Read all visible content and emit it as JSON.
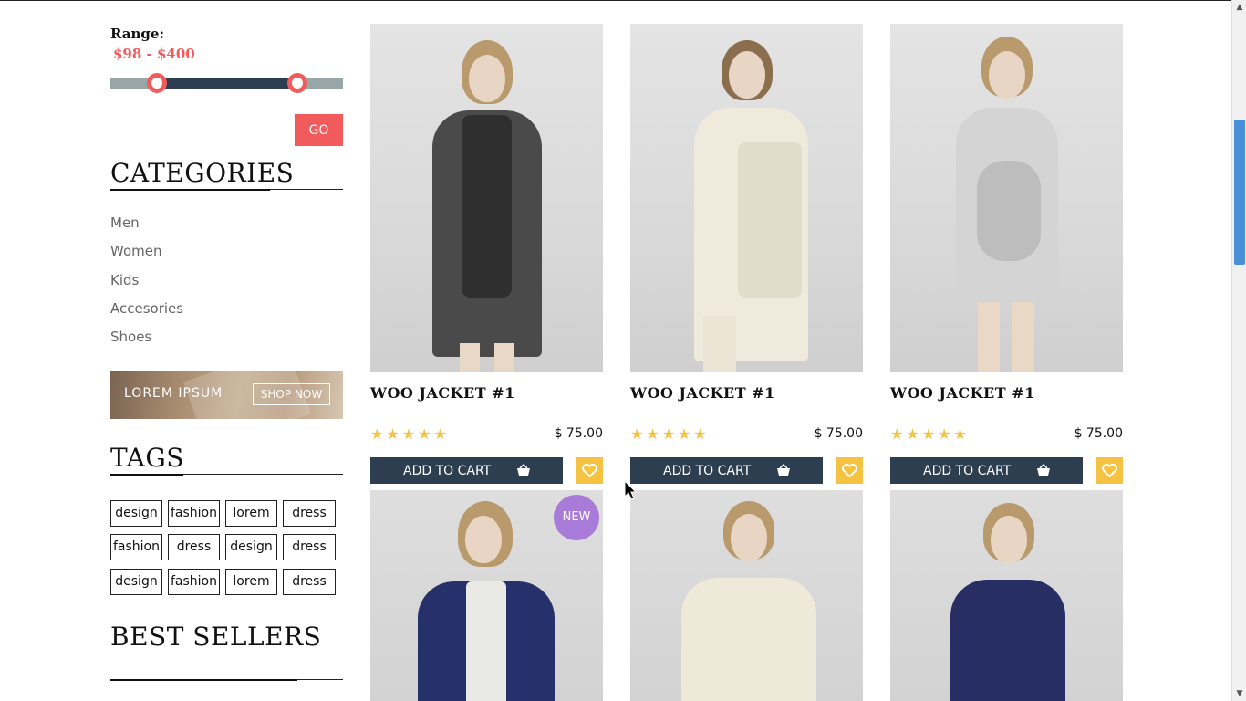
{
  "filter": {
    "range_label": "Range:",
    "range_value": "$98 - $400",
    "range_min": 98,
    "range_max": 400,
    "go_label": "GO"
  },
  "categories": {
    "heading": "CATEGORIES",
    "items": [
      "Men",
      "Women",
      "Kids",
      "Accesories",
      "Shoes"
    ]
  },
  "banner": {
    "text": "LOREM IPSUM",
    "button": "SHOP NOW"
  },
  "tags": {
    "heading": "TAGS",
    "items": [
      "design",
      "fashion",
      "lorem",
      "dress",
      "fashion",
      "dress",
      "design",
      "dress",
      "design",
      "fashion",
      "lorem",
      "dress"
    ]
  },
  "best_sellers": {
    "heading": "BEST SELLERS"
  },
  "products": [
    {
      "title": "WOO JACKET #1",
      "stars": "★★★★★",
      "price": "$ 75.00",
      "cart_label": "ADD TO CART"
    },
    {
      "title": "WOO JACKET #1",
      "stars": "★★★★★",
      "price": "$ 75.00",
      "cart_label": "ADD TO CART"
    },
    {
      "title": "WOO JACKET #1",
      "stars": "★★★★★",
      "price": "$ 75.00",
      "cart_label": "ADD TO CART"
    }
  ],
  "second_row": {
    "badge": "NEW"
  },
  "colors": {
    "accent": "#f25b5b",
    "navy": "#2e3e51",
    "yellow": "#f5c341",
    "badge_purple": "#a97bd8"
  },
  "icons": [
    "basket-icon",
    "heart-icon",
    "scroll-up-arrow",
    "scroll-down-arrow",
    "mouse-cursor"
  ]
}
